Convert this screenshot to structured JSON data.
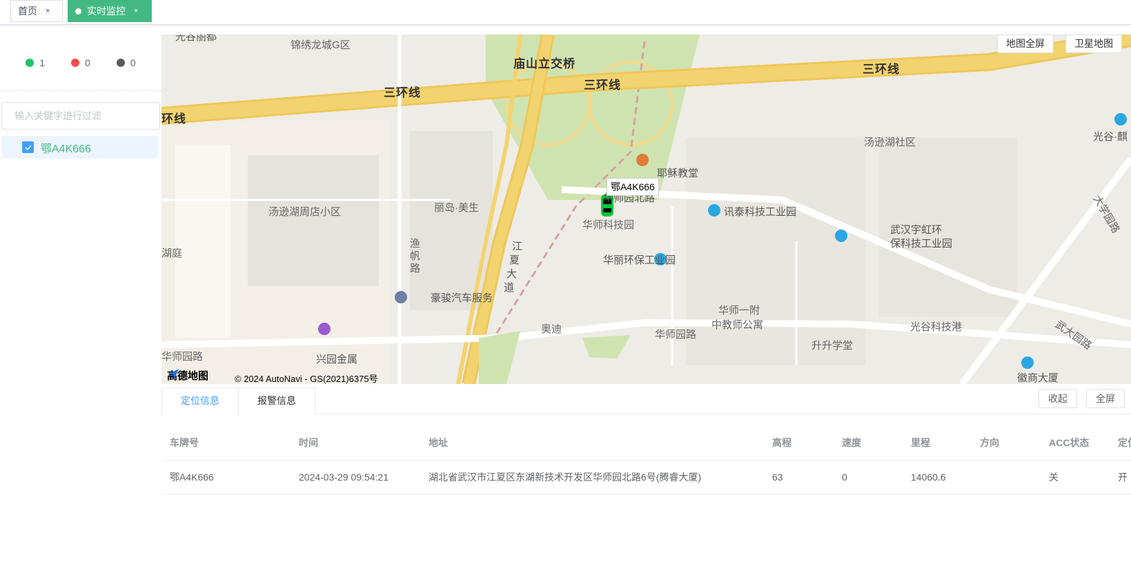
{
  "tabs": [
    {
      "label": "首页",
      "close": "×"
    },
    {
      "label": "实时监控",
      "close": "×"
    }
  ],
  "stats": {
    "online": {
      "count": "1",
      "color": "#1ec36b"
    },
    "alarm": {
      "count": "0",
      "color": "#f54a4a"
    },
    "offline": {
      "count": "0",
      "color": "#5b5b5b"
    }
  },
  "filter": {
    "placeholder": "输入关键字进行过滤"
  },
  "tree": {
    "vehicle": "鄂A4K666"
  },
  "map": {
    "buttons": {
      "fullscreen": "地图全屏",
      "satellite": "卫星地图"
    },
    "vehicle_tag": "鄂A4K666",
    "logo": "高德地图",
    "copyright": "© 2024 AutoNavi - GS(2021)6375号",
    "labels": {
      "l1": "锦绣龙城G区",
      "l2": "庙山立交桥",
      "l3": "三环线",
      "l4": "三环线",
      "l5": "三环线",
      "l6": "环线",
      "l7": "汤逊湖社区",
      "l8": "光谷·麒",
      "l9": "耶稣教堂",
      "l10": "华师园北路",
      "l11": "汤逊湖周店小区",
      "l12": "丽岛·美生",
      "l13": "华师科技园",
      "l14": "讯泰科技工业园",
      "l15": "武汉宇虹环",
      "l16": "保科技工业园",
      "l17": "湖庭",
      "l18": "渔",
      "l19": "帆",
      "l20": "路",
      "l21": "江",
      "l22": "夏",
      "l23": "大",
      "l24": "道",
      "l25": "华丽环保工业园",
      "l26": "豪骏汽车服务",
      "l27": "奥迪",
      "l28": "华师一附",
      "l29": "中教师公寓",
      "l30": "华师园路",
      "l31": "光谷科技港",
      "l32": "升升学堂",
      "l33": "兴园金属",
      "l34": "华师园路",
      "l35": "徽商大厦",
      "l36": "武大园路",
      "l37": "大学园路",
      "l38": "光谷丽都"
    }
  },
  "bottom": {
    "tabs": {
      "location": "定位信息",
      "alarm": "报警信息"
    },
    "buttons": {
      "collapse": "收起",
      "fullscreen": "全屏"
    },
    "columns": [
      "车牌号",
      "时间",
      "地址",
      "高程",
      "速度",
      "里程",
      "方向",
      "ACC状态",
      "定位"
    ],
    "rows": [
      [
        "鄂A4K666",
        "2024-03-29 09:54:21",
        "湖北省武汉市江夏区东湖新技术开发区华师园北路6号(腾睿大厦)",
        "63",
        "0",
        "14060.6",
        "",
        "关",
        "开"
      ]
    ]
  }
}
